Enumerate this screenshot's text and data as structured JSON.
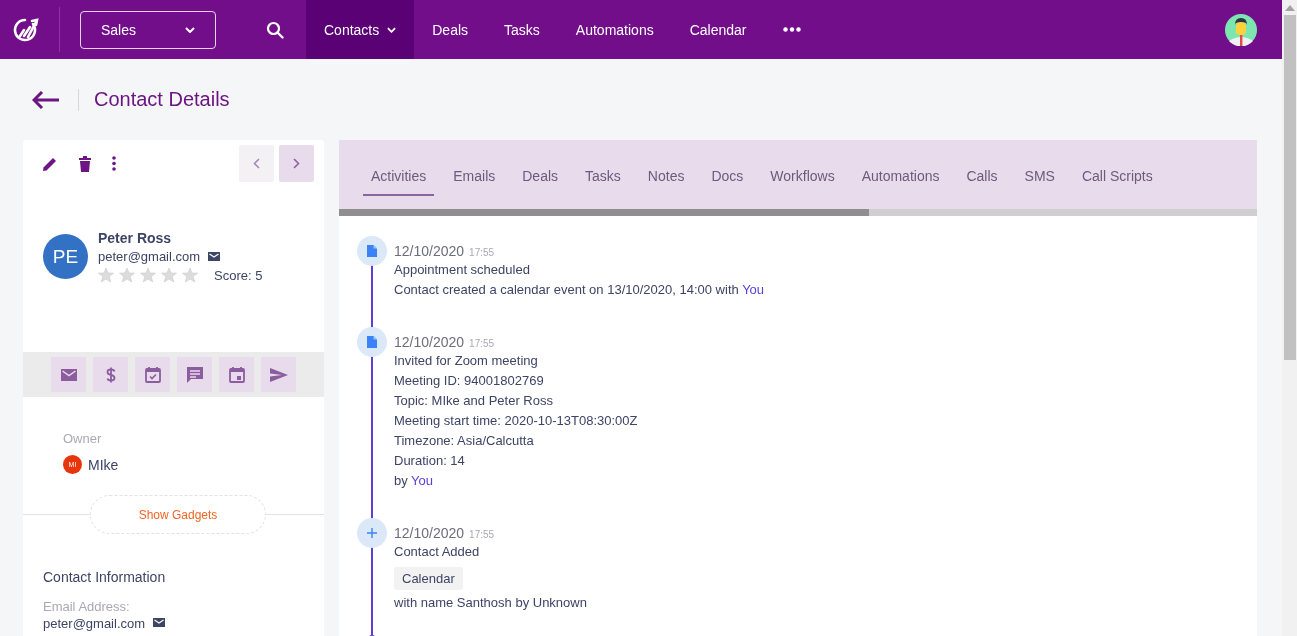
{
  "topbar": {
    "pipeline": "Sales",
    "nav": [
      {
        "label": "Contacts",
        "selected": true,
        "dropdown": true
      },
      {
        "label": "Deals",
        "selected": false,
        "dropdown": false
      },
      {
        "label": "Tasks",
        "selected": false,
        "dropdown": false
      },
      {
        "label": "Automations",
        "selected": false,
        "dropdown": false
      },
      {
        "label": "Calendar",
        "selected": false,
        "dropdown": false
      }
    ]
  },
  "page_title": "Contact Details",
  "pager": {
    "previous_disabled": true,
    "next_disabled": false
  },
  "contact": {
    "initials": "PE",
    "name": "Peter Ross",
    "email": "peter@gmail.com",
    "stars": 0,
    "score": "Score: 5"
  },
  "owner": {
    "label": "Owner",
    "initials": "MI",
    "name": "MIke"
  },
  "show_gadgets": "Show Gadgets",
  "contact_information": {
    "title": "Contact Information",
    "fields": [
      {
        "label": "Email Address:",
        "value": "peter@gmail.com"
      }
    ]
  },
  "tabs": [
    {
      "label": "Activities",
      "selected": true
    },
    {
      "label": "Emails",
      "selected": false
    },
    {
      "label": "Deals",
      "selected": false
    },
    {
      "label": "Tasks",
      "selected": false
    },
    {
      "label": "Notes",
      "selected": false
    },
    {
      "label": "Docs",
      "selected": false
    },
    {
      "label": "Workflows",
      "selected": false
    },
    {
      "label": "Automations",
      "selected": false
    },
    {
      "label": "Calls",
      "selected": false
    },
    {
      "label": "SMS",
      "selected": false
    },
    {
      "label": "Call Scripts",
      "selected": false
    }
  ],
  "activities": [
    {
      "kind": "document",
      "date": "12/10/2020",
      "time": "17:55",
      "lines": [
        {
          "kind": "text",
          "text": "Appointment scheduled"
        },
        {
          "kind": "text",
          "text": "Contact created a calendar event on 13/10/2020, 14:00 with ",
          "link": "You"
        }
      ]
    },
    {
      "kind": "document",
      "date": "12/10/2020",
      "time": "17:55",
      "lines": [
        {
          "kind": "text",
          "text": "Invited for Zoom meeting"
        },
        {
          "kind": "text",
          "text": "Meeting ID: 94001802769"
        },
        {
          "kind": "text",
          "text": "Topic: MIke and Peter Ross"
        },
        {
          "kind": "text",
          "text": "Meeting start time: 2020-10-13T08:30:00Z"
        },
        {
          "kind": "text",
          "text": "Timezone: Asia/Calcutta"
        },
        {
          "kind": "text",
          "text": "Duration: 14"
        },
        {
          "kind": "text",
          "text": "by ",
          "link": "You"
        }
      ]
    },
    {
      "kind": "added",
      "date": "12/10/2020",
      "time": "17:55",
      "lines": [
        {
          "kind": "text",
          "text": "Contact Added"
        },
        {
          "kind": "tag",
          "text": "Calendar"
        },
        {
          "kind": "text",
          "text": "with name Santhosh by Unknown"
        }
      ]
    }
  ]
}
